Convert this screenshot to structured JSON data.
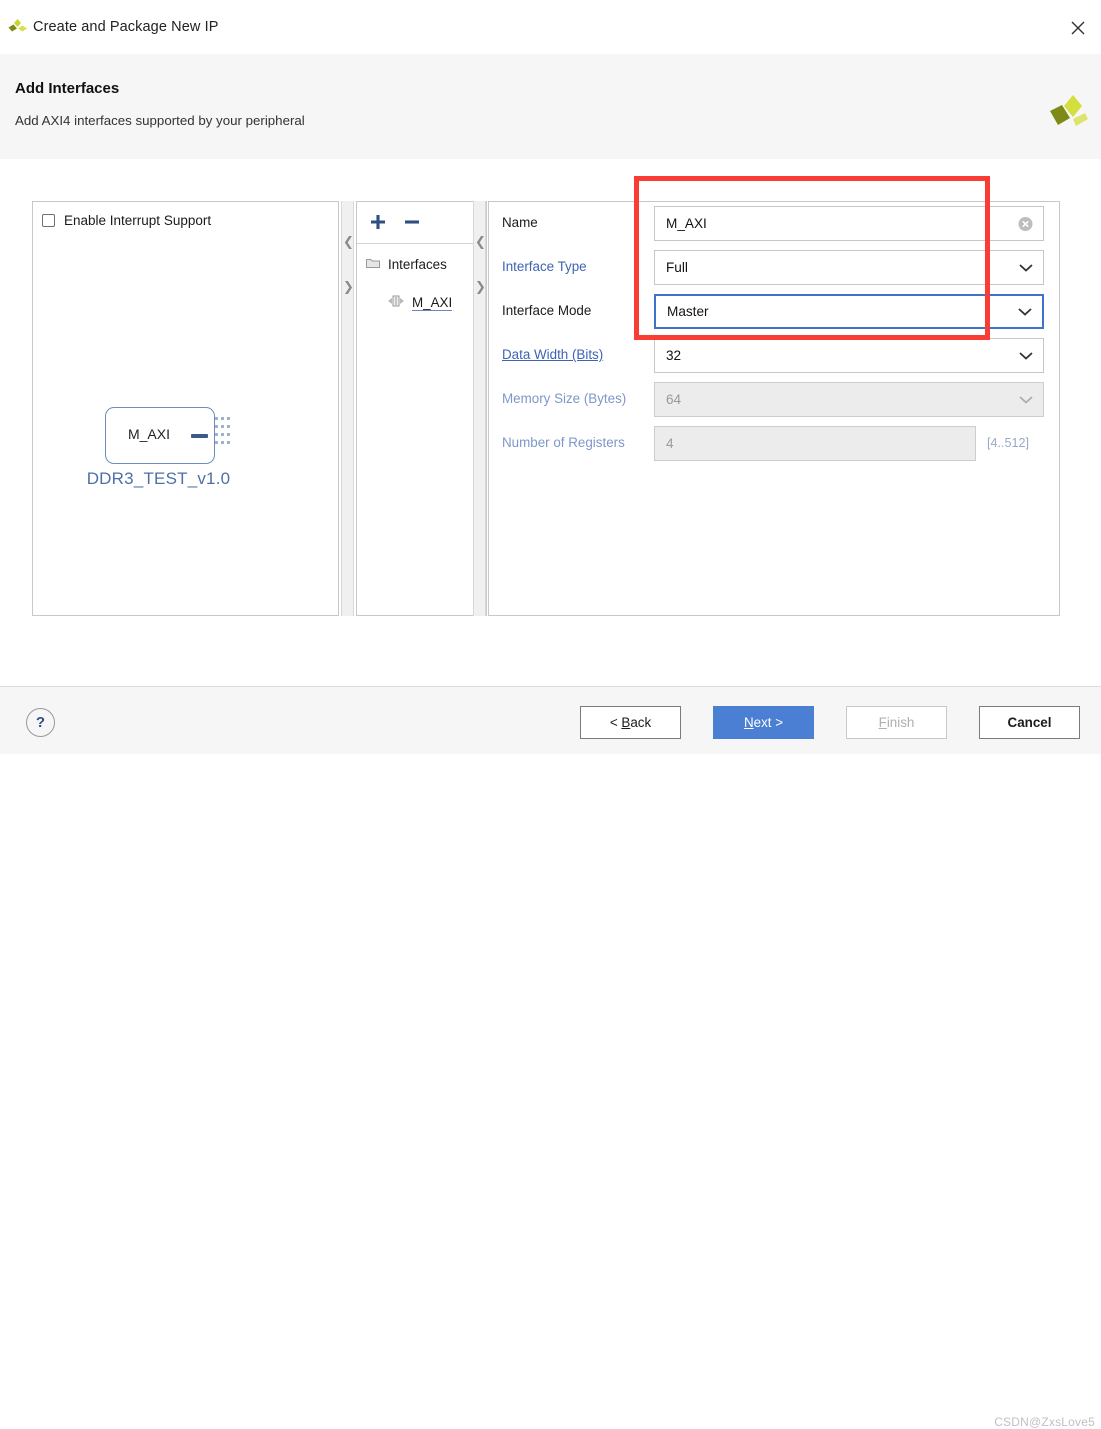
{
  "window": {
    "title": "Create and Package New IP",
    "close_label": "×",
    "logo_icon": "xilinx-logo-icon"
  },
  "header": {
    "title": "Add Interfaces",
    "subtitle": "Add AXI4 interfaces supported by your peripheral",
    "logo_icon": "xilinx-logo-icon"
  },
  "left_panel": {
    "checkbox": {
      "label": "Enable Interrupt Support",
      "checked": false
    },
    "diagram": {
      "block_label": "M_AXI",
      "ip_name": "DDR3_TEST_v1.0"
    }
  },
  "middle_panel": {
    "toolbar": {
      "add_label": "+",
      "remove_label": "−"
    },
    "tree": [
      {
        "label": "Interfaces",
        "icon": "folder-icon",
        "level": 0
      },
      {
        "label": "M_AXI",
        "icon": "interface-icon",
        "level": 1,
        "selected": true
      }
    ]
  },
  "form": {
    "rows": [
      {
        "label": "Name",
        "label_style": "plain",
        "value": "M_AXI",
        "control": "text",
        "enabled": true,
        "focused": false,
        "clear_icon": "clear-circle-icon"
      },
      {
        "label": "Interface Type",
        "label_style": "link",
        "value": "Full",
        "control": "select",
        "enabled": true,
        "focused": false
      },
      {
        "label": "Interface Mode",
        "label_style": "plain",
        "value": "Master",
        "control": "select",
        "enabled": true,
        "focused": true
      },
      {
        "label": "Data Width (Bits)",
        "label_style": "link-underline",
        "value": "32",
        "control": "select",
        "enabled": true,
        "focused": false
      },
      {
        "label": "Memory Size (Bytes)",
        "label_style": "dim",
        "value": "64",
        "control": "select",
        "enabled": false,
        "focused": false
      },
      {
        "label": "Number of Registers",
        "label_style": "dim",
        "value": "4",
        "control": "text",
        "enabled": false,
        "focused": false,
        "hint": "[4..512]"
      }
    ]
  },
  "footer": {
    "help_label": "?",
    "buttons": [
      {
        "name": "back",
        "prefix": "< ",
        "mnemonic": "B",
        "rest": "ack",
        "suffix": "",
        "state": "normal"
      },
      {
        "name": "next",
        "prefix": "",
        "mnemonic": "N",
        "rest": "ext",
        "suffix": " >",
        "state": "primary"
      },
      {
        "name": "finish",
        "prefix": "",
        "mnemonic": "F",
        "rest": "inish",
        "suffix": "",
        "state": "disabled"
      },
      {
        "name": "cancel",
        "prefix": "",
        "mnemonic": "",
        "rest": "Cancel",
        "suffix": "",
        "state": "normal"
      }
    ]
  },
  "annotation": {
    "highlight_color": "#f93c34"
  },
  "watermark": "CSDN@ZxsLove5"
}
